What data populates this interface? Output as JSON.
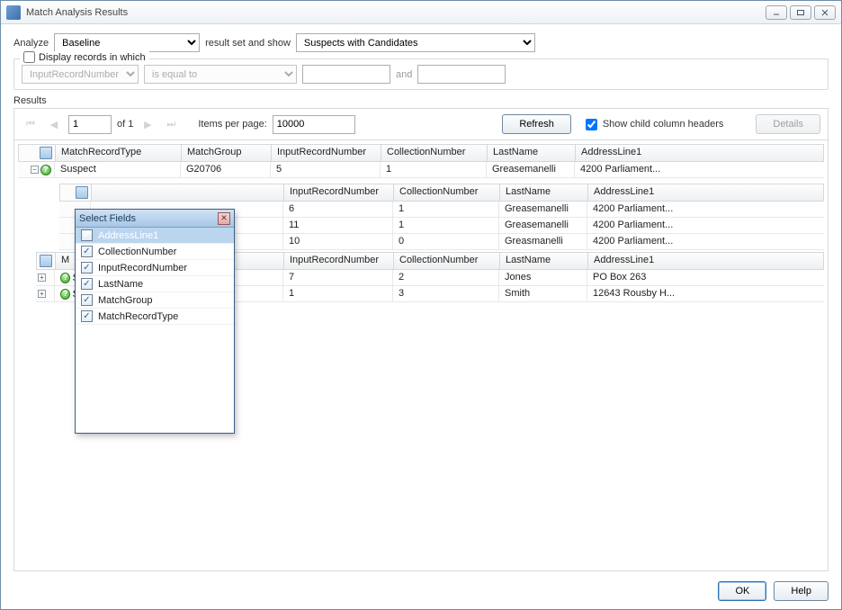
{
  "window": {
    "title": "Match Analysis Results"
  },
  "toolbar": {
    "analyze_label": "Analyze",
    "analyze_value": "Baseline",
    "mid_label": "result set and show",
    "show_value": "Suspects with Candidates"
  },
  "filter": {
    "legend": "Display records in which",
    "field": "InputRecordNumber",
    "op": "is equal to",
    "and_label": "and"
  },
  "results_label": "Results",
  "pager": {
    "page": "1",
    "of_label": "of 1",
    "ipp_label": "Items per page:",
    "ipp_value": "10000",
    "refresh": "Refresh",
    "show_child_label": "Show child column headers",
    "details": "Details"
  },
  "columns": {
    "type": "MatchRecordType",
    "group": "MatchGroup",
    "irn": "InputRecordNumber",
    "coll": "CollectionNumber",
    "last": "LastName",
    "addr": "AddressLine1"
  },
  "rows": {
    "r1": {
      "type": "Suspect",
      "group": "G20706",
      "irn": "5",
      "coll": "1",
      "last": "Greasemanelli",
      "addr": "4200 Parliament..."
    },
    "r2": {
      "irn": "6",
      "coll": "1",
      "last": "Greasemanelli",
      "addr": "4200 Parliament..."
    },
    "r3": {
      "irn": "11",
      "coll": "1",
      "last": "Greasemanelli",
      "addr": "4200 Parliament..."
    },
    "r4": {
      "irn": "10",
      "coll": "0",
      "last": "Greasmanelli",
      "addr": "4200 Parliament..."
    },
    "r5": {
      "irn": "7",
      "coll": "2",
      "last": "Jones",
      "addr": "PO Box 263"
    },
    "r6": {
      "irn": "1",
      "coll": "3",
      "last": "Smith",
      "addr": "12643 Rousby H..."
    }
  },
  "truncated": {
    "m_prefix": "M",
    "s_prefix": "S"
  },
  "popup": {
    "title": "Select Fields",
    "items": [
      "AddressLine1",
      "CollectionNumber",
      "InputRecordNumber",
      "LastName",
      "MatchGroup",
      "MatchRecordType"
    ]
  },
  "footer": {
    "ok": "OK",
    "help": "Help"
  }
}
